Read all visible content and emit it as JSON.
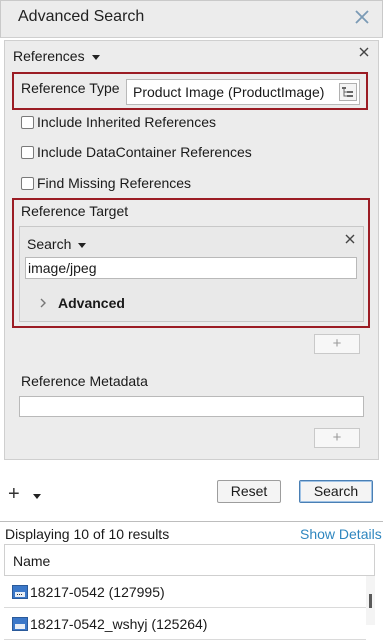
{
  "window": {
    "title": "Advanced Search"
  },
  "references_section": {
    "label": "References"
  },
  "reference_type": {
    "label": "Reference Type",
    "value": "Product Image (ProductImage)"
  },
  "checkboxes": [
    {
      "label": "Include Inherited References",
      "checked": false
    },
    {
      "label": "Include DataContainer References",
      "checked": false
    },
    {
      "label": "Find Missing References",
      "checked": false
    }
  ],
  "reference_target": {
    "label": "Reference Target",
    "search_label": "Search",
    "search_value": "image/jpeg",
    "advanced_label": "Advanced",
    "add_symbol": "+"
  },
  "reference_metadata": {
    "label": "Reference Metadata",
    "value": "",
    "add_symbol": "+"
  },
  "toolbar": {
    "add_symbol": "+",
    "reset_label": "Reset",
    "search_label": "Search"
  },
  "results": {
    "summary": "Displaying 10 of 10 results",
    "details_link": "Show Details",
    "column_name": "Name",
    "rows": [
      {
        "name": "18217-0542 (127995)"
      },
      {
        "name": "18217-0542_wshyj (125264)"
      }
    ]
  },
  "colors": {
    "highlight_border": "#9b1c24",
    "link": "#2e86bf",
    "panel_bg": "#ececec"
  }
}
